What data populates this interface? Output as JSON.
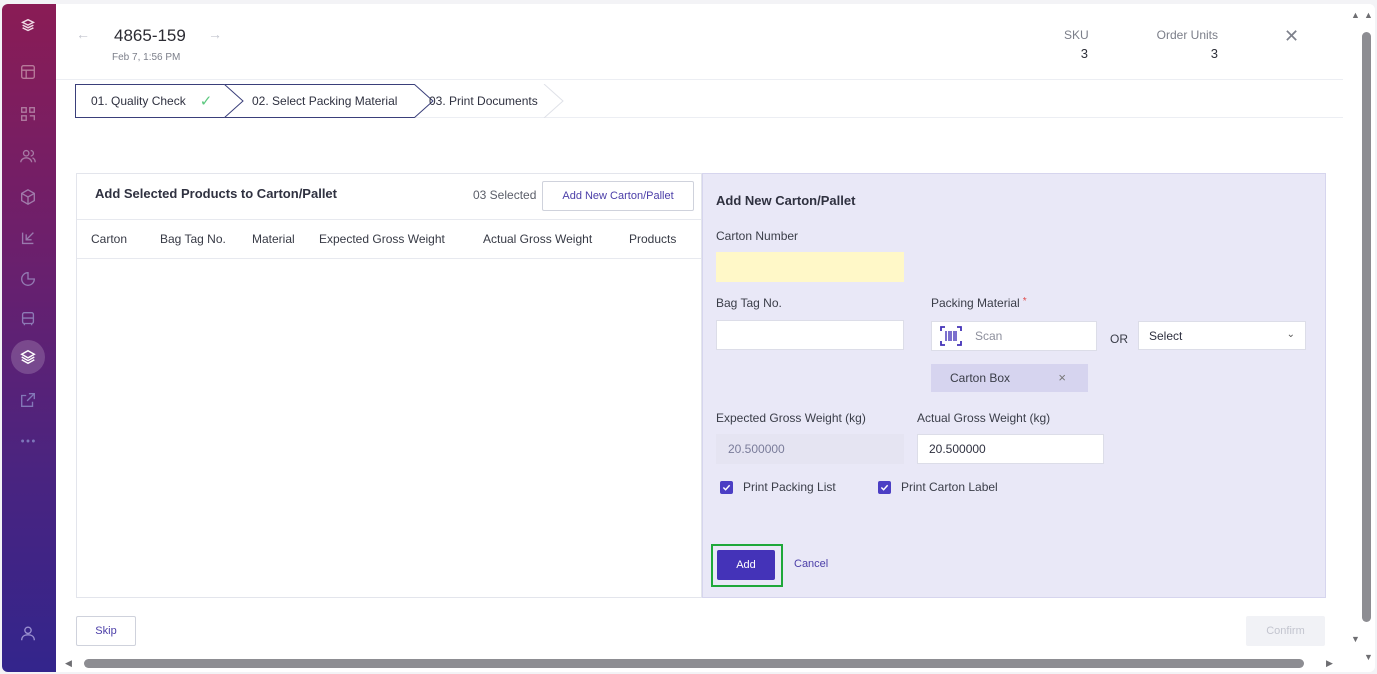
{
  "header": {
    "order_id": "4865-159",
    "order_date": "Feb 7, 1:56 PM",
    "sku_label": "SKU",
    "sku_value": "3",
    "order_units_label": "Order Units",
    "order_units_value": "3"
  },
  "stepper": {
    "steps": [
      {
        "label": "01. Quality Check",
        "status": "done"
      },
      {
        "label": "02. Select Packing Material",
        "status": "active"
      },
      {
        "label": "03. Print Documents",
        "status": "pending"
      }
    ]
  },
  "left_panel": {
    "title": "Add Selected Products to Carton/Pallet",
    "selected_text": "03 Selected",
    "add_new_button": "Add New Carton/Pallet",
    "columns": [
      "Carton",
      "Bag Tag No.",
      "Material",
      "Expected Gross Weight",
      "Actual Gross Weight",
      "Products"
    ],
    "rows": []
  },
  "right_panel": {
    "title": "Add New Carton/Pallet",
    "carton_number_label": "Carton Number",
    "carton_number_value": "",
    "bag_tag_label": "Bag Tag No.",
    "bag_tag_value": "",
    "packing_material_label": "Packing Material",
    "packing_material_required": "*",
    "scan_placeholder": "Scan",
    "or_text": "OR",
    "select_value": "Select",
    "selected_chip": "Carton Box",
    "expected_weight_label": "Expected Gross Weight (kg)",
    "expected_weight_value": "20.500000",
    "actual_weight_label": "Actual Gross Weight (kg)",
    "actual_weight_value": "20.500000",
    "print_packing_list_label": "Print Packing List",
    "print_packing_list_checked": true,
    "print_carton_label_label": "Print Carton Label",
    "print_carton_label_checked": true,
    "add_button": "Add",
    "cancel_link": "Cancel"
  },
  "footer": {
    "skip_button": "Skip",
    "confirm_button": "Confirm"
  },
  "sidebar": {
    "icons": [
      "cube-stack-icon",
      "layout-icon",
      "qr-grid-icon",
      "users-icon",
      "box-icon",
      "import-icon",
      "pie-chart-icon",
      "bus-icon",
      "layers-icon",
      "external-link-icon",
      "more-icon",
      "user-icon"
    ],
    "active_icon": "layers-icon"
  },
  "colors": {
    "accent": "#4433b8",
    "highlight": "#1fa83a",
    "panel_bg": "#e9e8f7",
    "check_green": "#5cc87f"
  }
}
